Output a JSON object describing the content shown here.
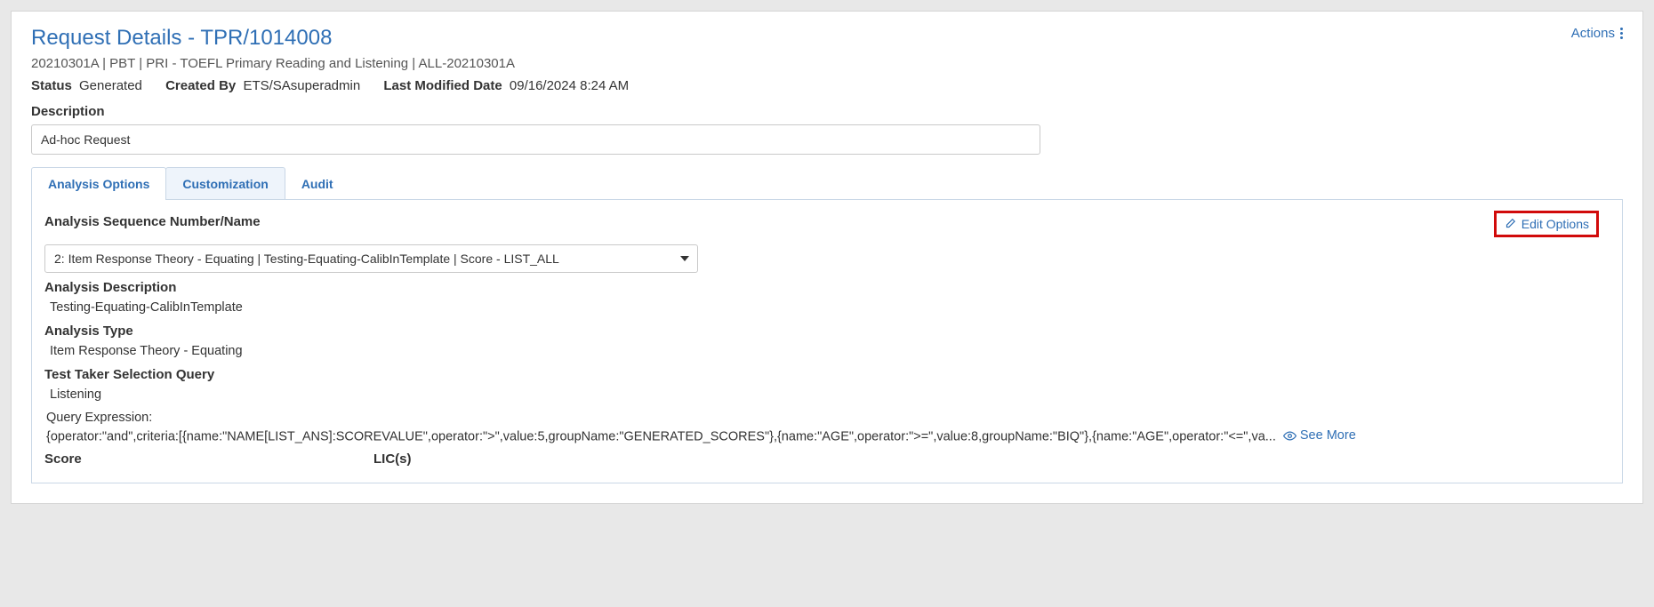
{
  "header": {
    "title": "Request Details - TPR/1014008",
    "subtitle": "20210301A | PBT | PRI - TOEFL Primary Reading and Listening | ALL-20210301A",
    "status_label": "Status",
    "status_value": "Generated",
    "created_by_label": "Created By",
    "created_by_value": "ETS/SAsuperadmin",
    "last_modified_label": "Last Modified Date",
    "last_modified_value": "09/16/2024 8:24 AM",
    "actions_label": "Actions"
  },
  "description": {
    "label": "Description",
    "value": "Ad-hoc Request"
  },
  "tabs": {
    "analysis_options": "Analysis Options",
    "customization": "Customization",
    "audit": "Audit"
  },
  "analysis": {
    "seq_label": "Analysis Sequence Number/Name",
    "seq_selected": "2: Item Response Theory - Equating | Testing-Equating-CalibInTemplate | Score - LIST_ALL",
    "edit_options_label": "Edit Options",
    "desc_label": "Analysis Description",
    "desc_value": "Testing-Equating-CalibInTemplate",
    "type_label": "Analysis Type",
    "type_value": "Item Response Theory - Equating",
    "tts_label": "Test Taker Selection Query",
    "tts_value": "Listening",
    "query_label": "Query Expression:",
    "query_value": "{operator:\"and\",criteria:[{name:\"NAME[LIST_ANS]:SCOREVALUE\",operator:\">\",value:5,groupName:\"GENERATED_SCORES\"},{name:\"AGE\",operator:\">=\",value:8,groupName:\"BIQ\"},{name:\"AGE\",operator:\"<=\",va...",
    "see_more_label": "See More",
    "score_header": "Score",
    "lic_header": "LIC(s)"
  }
}
